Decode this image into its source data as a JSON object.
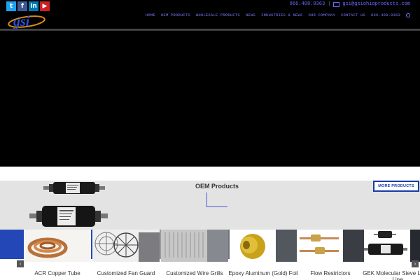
{
  "header": {
    "social": [
      {
        "icon": "twitter-icon",
        "glyph": "t"
      },
      {
        "icon": "facebook-icon",
        "glyph": "f"
      },
      {
        "icon": "linkedin-icon",
        "glyph": "in"
      },
      {
        "icon": "youtube-icon",
        "glyph": "▶"
      }
    ],
    "logo_text": "gsi",
    "phone": "866.408.0363",
    "email": "gsi@gsiohioproducts.com",
    "nav": [
      "HOME",
      "OEM PRODUCTS",
      "WHOLESALE PRODUCTS",
      "NEWS",
      "INDUSTRIES & NEWS",
      "OUR COMPANY",
      "CONTACT US",
      "866.408.0363"
    ]
  },
  "oem": {
    "title": "OEM Products",
    "more_label": "MORE PRODUCTS"
  },
  "carousel": {
    "items": [
      {
        "label": "ACR Copper Tube"
      },
      {
        "label": "Customized Fan Guard"
      },
      {
        "label": "Customized Wire Grills"
      },
      {
        "label": "Epoxy Aluminum (Gold) Foil"
      },
      {
        "label": "Flow Restrictors"
      },
      {
        "label": "GEK Molecular Sieve Liquid Line"
      }
    ],
    "prev_glyph": "‹",
    "next_glyph": "›"
  },
  "colors": {
    "accent": "#1a3aa8",
    "nav_text": "#7a7aff",
    "oem_band": "#e3e3e3",
    "strip_blue": "#2447b8"
  }
}
